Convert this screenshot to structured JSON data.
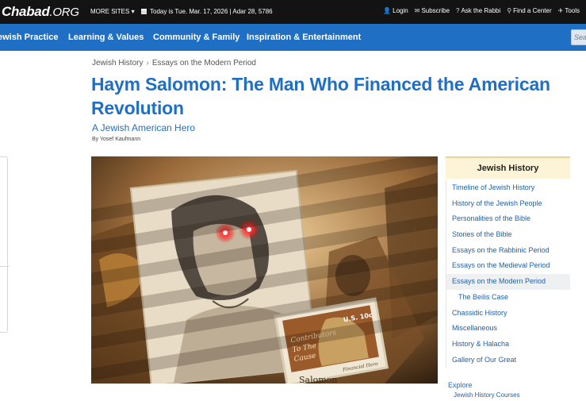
{
  "topbar": {
    "logo_main": "Chabad",
    "logo_suffix": ".ORG",
    "more_sites": "MORE SITES ▾",
    "date_text": "Today is Tue. Mar. 17, 2026 | Adar 28, 5786",
    "links": [
      {
        "icon": "user-icon",
        "glyph": "👤",
        "label": "Login"
      },
      {
        "icon": "envelope-icon",
        "glyph": "✉",
        "label": "Subscribe"
      },
      {
        "icon": "question-icon",
        "glyph": "?",
        "label": "Ask the Rabbi"
      },
      {
        "icon": "location-pin-icon",
        "glyph": "⚲",
        "label": "Find a Center"
      },
      {
        "icon": "tools-icon",
        "glyph": "✈",
        "label": "Tools"
      }
    ]
  },
  "nav": {
    "items": [
      {
        "label": "ewish Practice"
      },
      {
        "label": "Learning & Values"
      },
      {
        "label": "Community & Family"
      },
      {
        "label": "Inspiration & Entertainment"
      }
    ],
    "search_placeholder": "Search"
  },
  "breadcrumb": [
    "Jewish History",
    "Essays on the Modern Period"
  ],
  "breadcrumb_sep": "›",
  "article": {
    "title": "Haym Salomon: The Man Who Financed the American Revolution",
    "subtitle": "A Jewish American Hero",
    "byline": "By Yosef Kaufmann",
    "image_stamp_lines": [
      "Contributors",
      "To The",
      "Cause"
    ],
    "image_stamp_value": "U.S. 10c",
    "image_stamp_caption": "Financial Hero",
    "image_caption_name": "Salomon"
  },
  "sidebar": {
    "heading": "Jewish History",
    "items": [
      {
        "label": "Timeline of Jewish History",
        "kind": "normal"
      },
      {
        "label": "History of the Jewish People",
        "kind": "normal"
      },
      {
        "label": "Personalities of the Bible",
        "kind": "normal"
      },
      {
        "label": "Stories of the Bible",
        "kind": "normal"
      },
      {
        "label": "Essays on the Rabbinic Period",
        "kind": "normal"
      },
      {
        "label": "Essays on the Medieval Period",
        "kind": "normal"
      },
      {
        "label": "Essays on the Modern Period",
        "kind": "active"
      },
      {
        "label": "The Beilis Case",
        "kind": "sub"
      },
      {
        "label": "Chassidic History",
        "kind": "normal"
      },
      {
        "label": "Miscellaneous",
        "kind": "normal"
      },
      {
        "label": "History & Halacha",
        "kind": "normal"
      },
      {
        "label": "Gallery of Our Great",
        "kind": "normal"
      }
    ],
    "explore_label": "Explore",
    "explore_link": "Jewish History Courses"
  },
  "colors": {
    "topbar_bg": "#131313",
    "nav_bg": "#1f6fc5",
    "accent_blue": "#1f6fc5",
    "sidebar_head_bg": "#fdf3d6",
    "eye_glow": "#ff2a2a"
  }
}
